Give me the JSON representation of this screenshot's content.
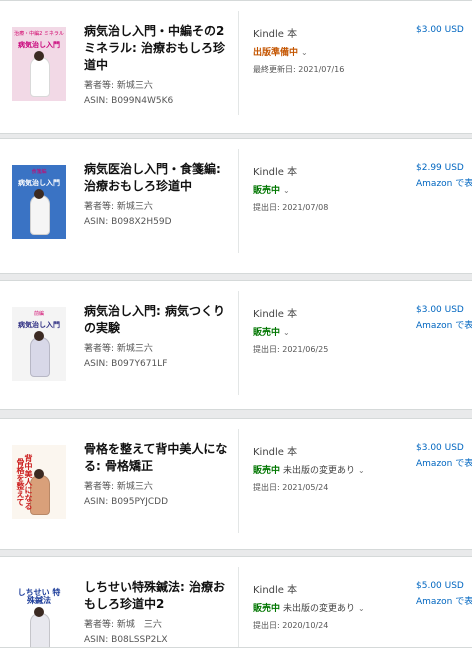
{
  "books": [
    {
      "title": "病気治し入門・中編その2 ミネラル: 治療おもしろ珍道中",
      "author_label": "著者等: 新城三六",
      "asin_label": "ASIN: B099N4W5K6",
      "format": "Kindle 本",
      "status": "出版準備中",
      "status_color": "#c45500",
      "status_extra": "",
      "date_label": "最終更新日: 2021/07/16",
      "price": "$3.00 USD",
      "price_sub": "",
      "cover": {
        "bg": "#f2d9e6",
        "subtitle": "治療・中編2 ミネラル",
        "title": "病気治し入門",
        "title_color": "#c8007a",
        "figure_color": "#ffffff"
      }
    },
    {
      "title": "病気医治し入門・食箋編: 治療おもしろ珍道中",
      "author_label": "著者等: 新城三六",
      "asin_label": "ASIN: B098X2H59D",
      "format": "Kindle 本",
      "status": "販売中",
      "status_color": "#007600",
      "status_extra": "",
      "date_label": "提出日: 2021/07/08",
      "price": "$2.99 USD",
      "price_sub": "Amazon で表",
      "cover": {
        "bg": "#3a73c4",
        "subtitle": "食箋編",
        "title": "病気治し入門",
        "title_color": "#ffffff",
        "figure_color": "#f5f5f5"
      }
    },
    {
      "title": "病気治し入門: 病気つくりの実験",
      "author_label": "著者等: 新城三六",
      "asin_label": "ASIN: B097Y671LF",
      "format": "Kindle 本",
      "status": "販売中",
      "status_color": "#007600",
      "status_extra": "",
      "date_label": "提出日: 2021/06/25",
      "price": "$3.00 USD",
      "price_sub": "Amazon で表",
      "cover": {
        "bg": "#f4f4f4",
        "subtitle": "前編",
        "title": "病気治し入門",
        "title_color": "#2a2a80",
        "figure_color": "#d8d8e8"
      }
    },
    {
      "title": "骨格を整えて背中美人になる: 骨格矯正",
      "author_label": "著者等: 新城三六",
      "asin_label": "ASIN: B095PYJCDD",
      "format": "Kindle 本",
      "status": "販売中",
      "status_color": "#007600",
      "status_extra": "未出版の変更あり",
      "date_label": "提出日: 2021/05/24",
      "price": "$3.00 USD",
      "price_sub": "Amazon で表",
      "cover": {
        "bg": "#fbf6ef",
        "subtitle": "",
        "title": "背中美人になる 骨格を整えて",
        "title_color": "#cc1f1f",
        "figure_color": "#d9a07a"
      }
    },
    {
      "title": "しちせい特殊鍼法: 治療おもしろ珍道中2",
      "author_label": "著者等: 新城　三六",
      "asin_label": "ASIN: B08LSSP2LX",
      "format": "Kindle 本",
      "status": "販売中",
      "status_color": "#007600",
      "status_extra": "未出版の変更あり",
      "date_label": "提出日: 2020/10/24",
      "price": "$5.00 USD",
      "price_sub": "Amazon で表",
      "cover": {
        "bg": "#ffffff",
        "subtitle": "",
        "title": "しちせい 特殊鍼法",
        "title_color": "#1d3d9a",
        "figure_color": "#e8e8ee"
      }
    }
  ]
}
